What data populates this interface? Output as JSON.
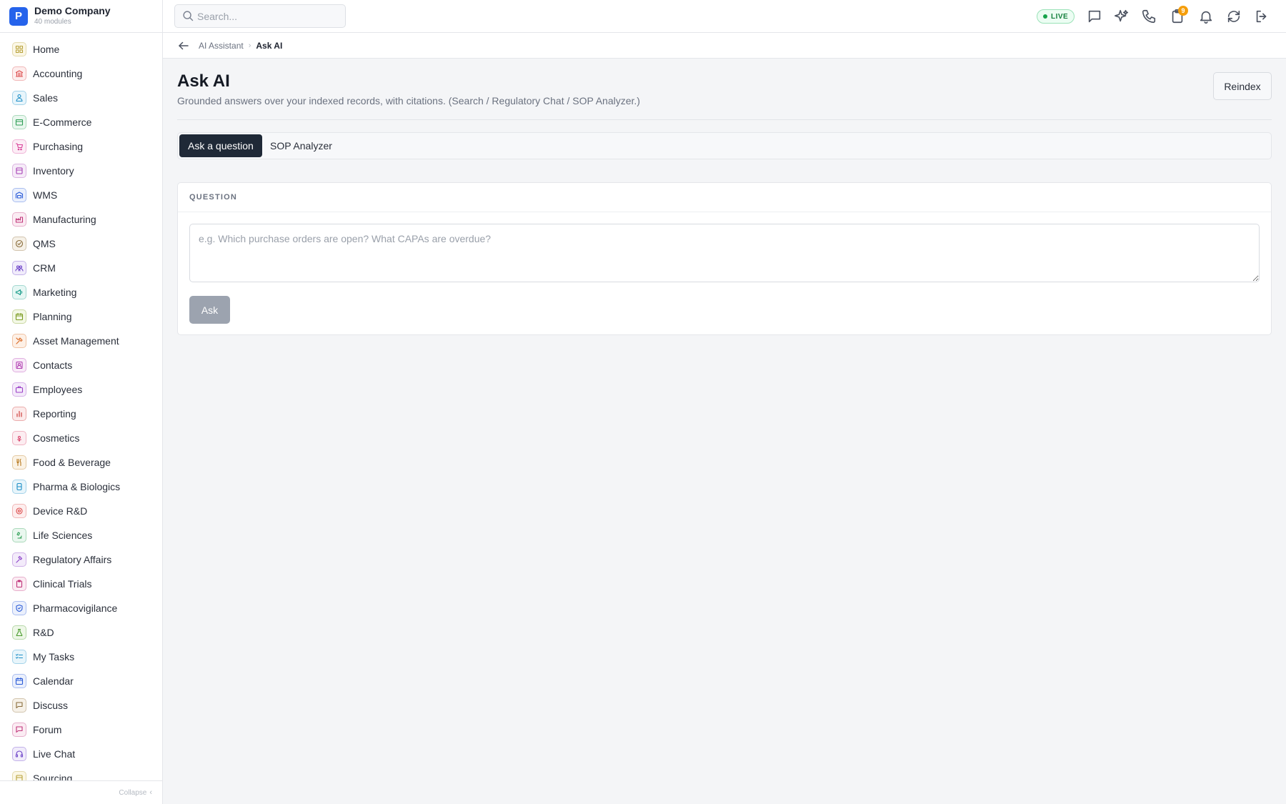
{
  "brand": {
    "logo_letter": "P",
    "name": "Demo Company",
    "subtitle": "40 modules"
  },
  "sidebar": {
    "items": [
      {
        "label": "Home",
        "icon": "grid-icon",
        "color": "#b8a23a",
        "bg": "#fbf7e6"
      },
      {
        "label": "Accounting",
        "icon": "bank-icon",
        "color": "#dc4a4a",
        "bg": "#fdeeee"
      },
      {
        "label": "Sales",
        "icon": "person-icon",
        "color": "#1e8fc7",
        "bg": "#e8f5fb"
      },
      {
        "label": "E-Commerce",
        "icon": "store-icon",
        "color": "#2e9e55",
        "bg": "#eaf7ef"
      },
      {
        "label": "Purchasing",
        "icon": "cart-icon",
        "color": "#d9439a",
        "bg": "#fcedf6"
      },
      {
        "label": "Inventory",
        "icon": "box-icon",
        "color": "#a63fb5",
        "bg": "#f6ecf8"
      },
      {
        "label": "WMS",
        "icon": "warehouse-icon",
        "color": "#2a5bd7",
        "bg": "#ebf0fc"
      },
      {
        "label": "Manufacturing",
        "icon": "factory-icon",
        "color": "#c0347a",
        "bg": "#fbecf3"
      },
      {
        "label": "QMS",
        "icon": "badge-check-icon",
        "color": "#8a6d3b",
        "bg": "#f6f1e8"
      },
      {
        "label": "CRM",
        "icon": "users-icon",
        "color": "#6a3fc7",
        "bg": "#f1ecfb"
      },
      {
        "label": "Marketing",
        "icon": "megaphone-icon",
        "color": "#1a9c8a",
        "bg": "#e7f7f4"
      },
      {
        "label": "Planning",
        "icon": "calendar-icon",
        "color": "#7a9a1f",
        "bg": "#f3f8e6"
      },
      {
        "label": "Asset Management",
        "icon": "tools-icon",
        "color": "#d9651f",
        "bg": "#fdf0e6"
      },
      {
        "label": "Contacts",
        "icon": "contact-icon",
        "color": "#b03bb0",
        "bg": "#f8ebf8"
      },
      {
        "label": "Employees",
        "icon": "briefcase-icon",
        "color": "#9b3fc7",
        "bg": "#f4ebfa"
      },
      {
        "label": "Reporting",
        "icon": "bar-chart-icon",
        "color": "#c9302c",
        "bg": "#fcebeb"
      },
      {
        "label": "Cosmetics",
        "icon": "flower-icon",
        "color": "#d9436a",
        "bg": "#fcedf1"
      },
      {
        "label": "Food & Beverage",
        "icon": "utensils-icon",
        "color": "#b7791f",
        "bg": "#fbf3e6"
      },
      {
        "label": "Pharma & Biologics",
        "icon": "pill-icon",
        "color": "#1e8fc7",
        "bg": "#e8f5fb"
      },
      {
        "label": "Device R&D",
        "icon": "cog-icon",
        "color": "#dc4a4a",
        "bg": "#fdeeee"
      },
      {
        "label": "Life Sciences",
        "icon": "microscope-icon",
        "color": "#2e9e55",
        "bg": "#eaf7ef"
      },
      {
        "label": "Regulatory Affairs",
        "icon": "gavel-icon",
        "color": "#8a3fc7",
        "bg": "#f3ebfa"
      },
      {
        "label": "Clinical Trials",
        "icon": "clipboard-icon",
        "color": "#c0347a",
        "bg": "#fbecf3"
      },
      {
        "label": "Pharmacovigilance",
        "icon": "shield-icon",
        "color": "#2a5bd7",
        "bg": "#ebf0fc"
      },
      {
        "label": "R&D",
        "icon": "flask-icon",
        "color": "#4a9c2e",
        "bg": "#eef7e8"
      },
      {
        "label": "My Tasks",
        "icon": "checklist-icon",
        "color": "#1e8fc7",
        "bg": "#e8f5fb"
      },
      {
        "label": "Calendar",
        "icon": "calendar-icon",
        "color": "#2a5bd7",
        "bg": "#ebf0fc"
      },
      {
        "label": "Discuss",
        "icon": "chat-icon",
        "color": "#8a6d3b",
        "bg": "#f6f1e8"
      },
      {
        "label": "Forum",
        "icon": "chat-icon",
        "color": "#c0347a",
        "bg": "#fbecf3"
      },
      {
        "label": "Live Chat",
        "icon": "headset-icon",
        "color": "#6a3fc7",
        "bg": "#f1ecfb"
      },
      {
        "label": "Sourcing",
        "icon": "box-icon",
        "color": "#b8a23a",
        "bg": "#fbf7e6"
      }
    ],
    "collapse_label": "Collapse"
  },
  "topbar": {
    "search_placeholder": "Search...",
    "live_label": "LIVE",
    "notification_count": "9",
    "icons": [
      "chat-icon",
      "sparkles-icon",
      "phone-icon",
      "clipboard-notify-icon",
      "bell-icon",
      "sync-icon",
      "logout-icon"
    ]
  },
  "breadcrumb": {
    "parent": "AI Assistant",
    "current": "Ask AI"
  },
  "page": {
    "title": "Ask AI",
    "subtitle": "Grounded answers over your indexed records, with citations. (Search / Regulatory Chat / SOP Analyzer.)",
    "reindex_label": "Reindex"
  },
  "tabs": {
    "active": "Ask a question",
    "other": "SOP Analyzer"
  },
  "question_card": {
    "header": "QUESTION",
    "placeholder": "e.g. Which purchase orders are open? What CAPAs are overdue?",
    "value": "",
    "ask_label": "Ask"
  }
}
